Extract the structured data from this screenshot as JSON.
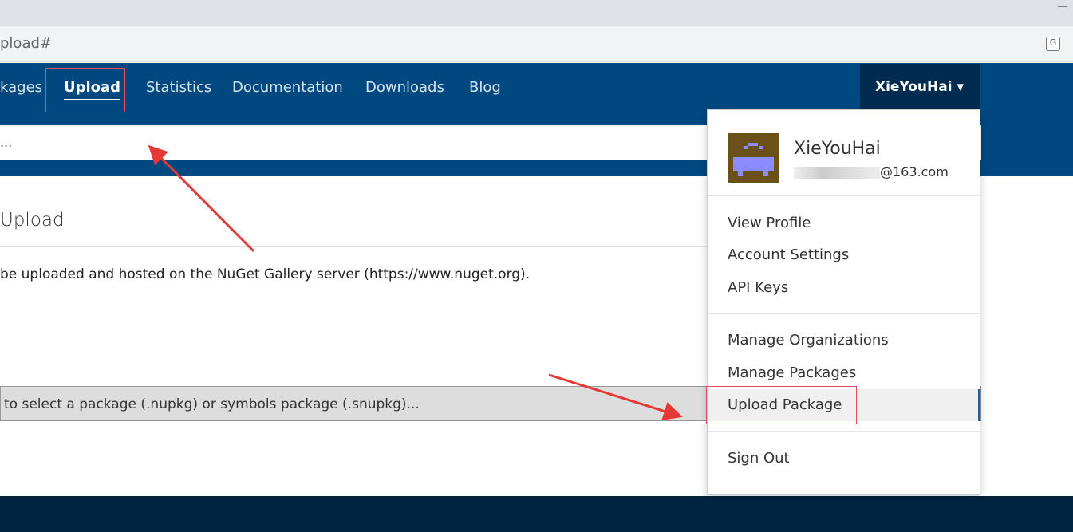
{
  "browser": {
    "url": "pload#",
    "minimize": "—",
    "translate_icon": "translate-icon"
  },
  "nav": {
    "items": [
      "kages",
      "Upload",
      "Statistics",
      "Documentation",
      "Downloads",
      "Blog"
    ],
    "user": "XieYouHai ▾"
  },
  "search": {
    "placeholder": "..."
  },
  "page": {
    "heading": "Upload",
    "description": "be uploaded and hosted on the NuGet Gallery server (https://www.nuget.org).",
    "file_prompt": "to select a package (.nupkg) or symbols package (.snupkg)..."
  },
  "menu": {
    "name": "XieYouHai",
    "email_suffix": "@163.com",
    "items": [
      "View Profile",
      "Account Settings",
      "API Keys",
      "Manage Organizations",
      "Manage Packages",
      "Upload Package",
      "Sign Out"
    ]
  },
  "colors": {
    "nav": "#004880",
    "annotation": "#e84a5f"
  }
}
